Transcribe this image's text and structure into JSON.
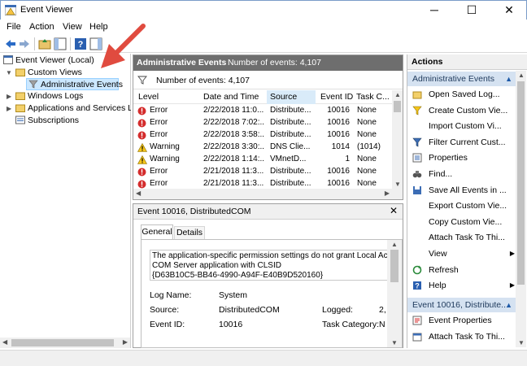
{
  "window": {
    "title": "Event Viewer"
  },
  "menu": [
    "File",
    "Action",
    "View",
    "Help"
  ],
  "tree": {
    "root": "Event Viewer (Local)",
    "custom_views": "Custom Views",
    "admin_events": "Administrative Events",
    "windows_logs": "Windows Logs",
    "apps_services": "Applications and Services Lo",
    "subscriptions": "Subscriptions"
  },
  "center": {
    "header_title": "Administrative Events",
    "header_count": "Number of events: 4,107",
    "filter_count": "Number of events: 4,107",
    "columns": [
      "Level",
      "Date and Time",
      "Source",
      "Event ID",
      "Task C..."
    ],
    "rows": [
      {
        "level": "Error",
        "date": "2/22/2018 11:0...",
        "source": "Distribute...",
        "id": "10016",
        "task": "None"
      },
      {
        "level": "Error",
        "date": "2/22/2018 7:02:...",
        "source": "Distribute...",
        "id": "10016",
        "task": "None"
      },
      {
        "level": "Error",
        "date": "2/22/2018 3:58:...",
        "source": "Distribute...",
        "id": "10016",
        "task": "None"
      },
      {
        "level": "Warning",
        "date": "2/22/2018 3:30:...",
        "source": "DNS Clie...",
        "id": "1014",
        "task": "(1014)"
      },
      {
        "level": "Warning",
        "date": "2/22/2018 1:14:...",
        "source": "VMnetD...",
        "id": "1",
        "task": "None"
      },
      {
        "level": "Error",
        "date": "2/21/2018 11:3...",
        "source": "Distribute...",
        "id": "10016",
        "task": "None"
      },
      {
        "level": "Error",
        "date": "2/21/2018 11:3...",
        "source": "Distribute...",
        "id": "10016",
        "task": "None"
      }
    ]
  },
  "detail": {
    "title": "Event 10016, DistributedCOM",
    "tabs": [
      "General",
      "Details"
    ],
    "message_l1": "The application-specific permission settings do not grant Local Act",
    "message_l2": "COM Server application with CLSID",
    "message_l3": "{D63B10C5-BB46-4990-A94F-E40B9D520160}",
    "log_name_label": "Log Name:",
    "log_name_value": "System",
    "source_label": "Source:",
    "source_value": "DistributedCOM",
    "logged_label": "Logged:",
    "logged_value": "2,",
    "event_id_label": "Event ID:",
    "event_id_value": "10016",
    "task_cat_label": "Task Category:",
    "task_cat_value": "N"
  },
  "actions": {
    "title": "Actions",
    "section1": "Administrative Events",
    "items1": [
      {
        "label": "Open Saved Log...",
        "icon": "folder-open-icon"
      },
      {
        "label": "Create Custom Vie...",
        "icon": "filter-star-icon"
      },
      {
        "label": "Import Custom Vi...",
        "icon": ""
      },
      {
        "label": "Filter Current Cust...",
        "icon": "filter-icon"
      },
      {
        "label": "Properties",
        "icon": "properties-icon"
      },
      {
        "label": "Find...",
        "icon": "binoculars-icon"
      },
      {
        "label": "Save All Events in ...",
        "icon": "save-icon"
      },
      {
        "label": "Export Custom Vie...",
        "icon": ""
      },
      {
        "label": "Copy Custom Vie...",
        "icon": ""
      },
      {
        "label": "Attach Task To Thi...",
        "icon": ""
      },
      {
        "label": "View",
        "icon": ""
      },
      {
        "label": "Refresh",
        "icon": "refresh-icon"
      },
      {
        "label": "Help",
        "icon": "help-icon"
      }
    ],
    "section2": "Event 10016, Distribute...",
    "items2": [
      {
        "label": "Event Properties",
        "icon": "event-properties-icon"
      },
      {
        "label": "Attach Task To Thi...",
        "icon": "attach-task-icon"
      }
    ]
  },
  "colors": {
    "accent": "#d5e2f1",
    "header_bg": "#6e6e6e",
    "arrow": "#e04b3f"
  }
}
